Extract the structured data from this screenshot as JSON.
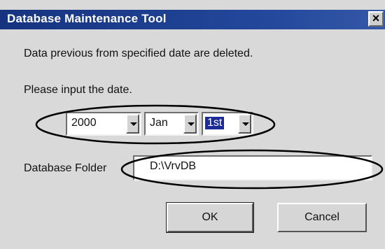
{
  "window": {
    "title": "Database Maintenance Tool",
    "close_label": "×"
  },
  "dialog": {
    "info_text": "Data previous from specified date are deleted.",
    "prompt_text": "Please input the date.",
    "date": {
      "year": "2000",
      "month": "Jan",
      "day": "1st"
    },
    "folder_label": "Database Folder",
    "folder_value": "D:\\VrvDB",
    "ok_label": "OK",
    "cancel_label": "Cancel"
  }
}
